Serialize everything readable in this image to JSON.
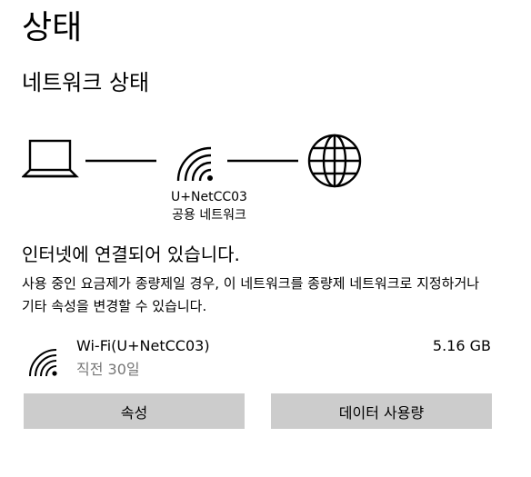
{
  "page": {
    "title": "상태"
  },
  "network_status": {
    "heading": "네트워크 상태",
    "diagram": {
      "icons": [
        "laptop-icon",
        "wifi-icon",
        "globe-icon"
      ],
      "network_name": "U+NetCC03",
      "network_type": "공용 네트워크"
    },
    "status_text": "인터넷에 연결되어 있습니다.",
    "description": "사용 중인 요금제가 종량제일 경우, 이 네트워크를 종량제 네트워크로 지정하거나 기타 속성을 변경할 수 있습니다."
  },
  "connection": {
    "icon": "wifi-icon",
    "name": "Wi-Fi(U+NetCC03)",
    "period": "직전 30일",
    "usage": "5.16 GB"
  },
  "buttons": {
    "properties": "속성",
    "data_usage": "데이터 사용량"
  }
}
